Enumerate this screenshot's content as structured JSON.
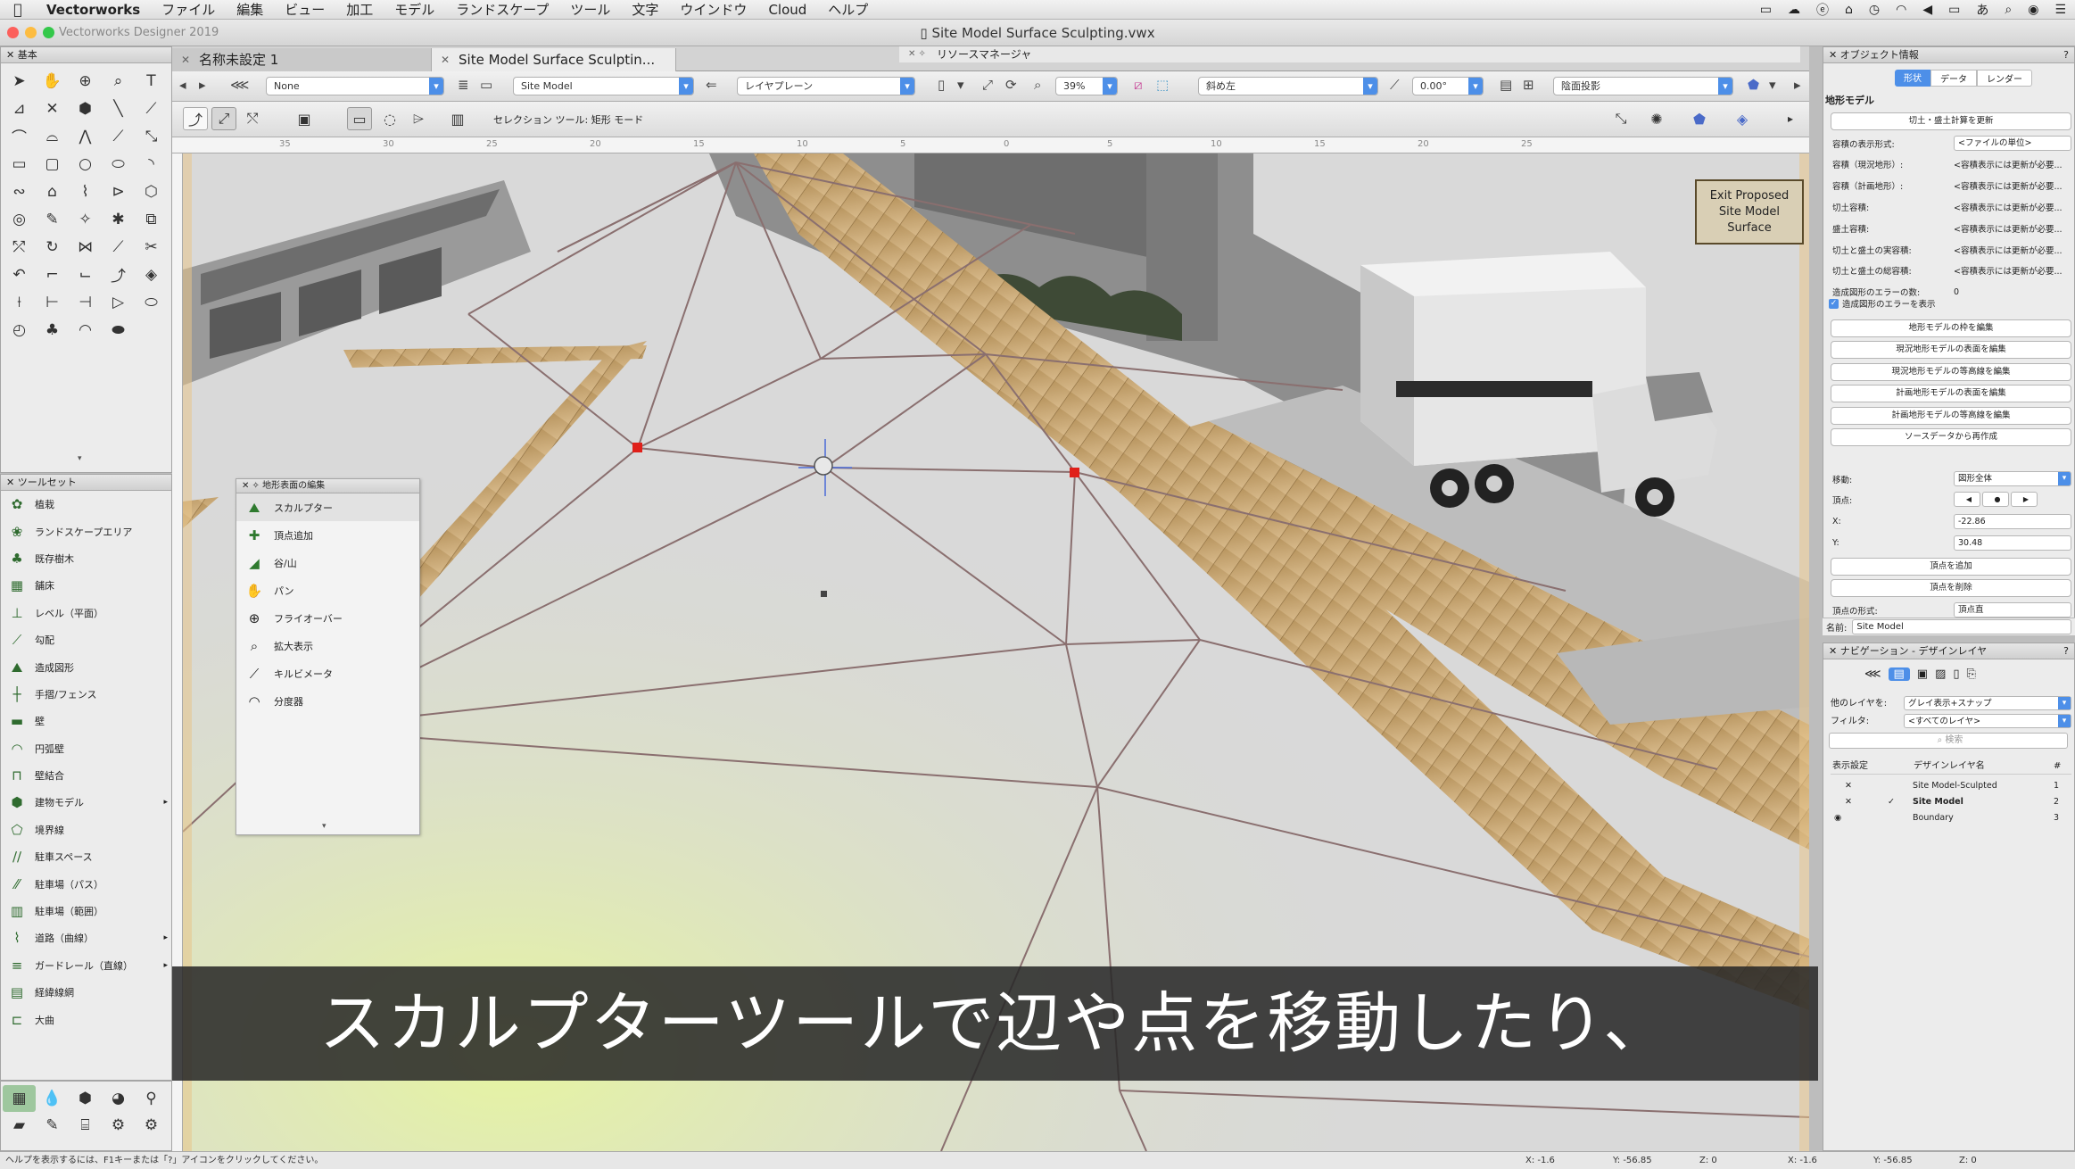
{
  "menubar": {
    "items": [
      "Vectorworks",
      "ファイル",
      "編集",
      "ビュー",
      "加工",
      "モデル",
      "ランドスケープ",
      "ツール",
      "文字",
      "ウインドウ",
      "Cloud",
      "ヘルプ"
    ]
  },
  "window": {
    "app_name": "Vectorworks Designer 2019",
    "title": "Site Model Surface Sculpting.vwx"
  },
  "tabs": [
    {
      "label": "名称未設定 1"
    },
    {
      "label": "Site Model Surface Sculptin..."
    },
    {
      "label": "リソースマネージャ"
    }
  ],
  "palettes": {
    "basic": "基本",
    "toolset": "ツールセット",
    "object_info": "オブジェクト情報",
    "navigation": "ナビゲーション - デザインレイヤ",
    "edit_surface": "地形表面の編集"
  },
  "viewbar": {
    "class": "None",
    "layer": "Site Model",
    "layer_plane": "レイヤプレーン",
    "zoom": "39%",
    "view": "斜め左",
    "angle": "0.00°",
    "render": "陰面投影"
  },
  "modebar": {
    "status": "セレクション ツール: 矩形 モード"
  },
  "ruler": {
    "ticks": [
      "35",
      "30",
      "25",
      "20",
      "15",
      "10",
      "5",
      "0",
      "5",
      "10",
      "15",
      "20",
      "25"
    ]
  },
  "toolset": [
    {
      "label": "植栽",
      "icon": "plant-icon"
    },
    {
      "label": "ランドスケープエリア",
      "icon": "landscape-area-icon"
    },
    {
      "label": "既存樹木",
      "icon": "existing-tree-icon"
    },
    {
      "label": "舗床",
      "icon": "hardscape-icon"
    },
    {
      "label": "レベル（平面）",
      "icon": "level-icon"
    },
    {
      "label": "勾配",
      "icon": "slope-icon"
    },
    {
      "label": "造成図形",
      "icon": "site-modifier-icon"
    },
    {
      "label": "手摺/フェンス",
      "icon": "railing-icon"
    },
    {
      "label": "壁",
      "icon": "wall-icon"
    },
    {
      "label": "円弧壁",
      "icon": "round-wall-icon"
    },
    {
      "label": "壁結合",
      "icon": "wall-join-icon"
    },
    {
      "label": "建物モデル",
      "icon": "building-model-icon"
    },
    {
      "label": "境界線",
      "icon": "boundary-icon"
    },
    {
      "label": "駐車スペース",
      "icon": "parking-space-icon"
    },
    {
      "label": "駐車場（パス）",
      "icon": "parking-path-icon"
    },
    {
      "label": "駐車場（範囲）",
      "icon": "parking-area-icon"
    },
    {
      "label": "道路（曲線）",
      "icon": "road-curve-icon"
    },
    {
      "label": "ガードレール（直線）",
      "icon": "guardrail-icon"
    },
    {
      "label": "経緯線網",
      "icon": "graticule-icon"
    },
    {
      "label": "大曲",
      "icon": "curve-road-icon"
    }
  ],
  "edit_surface_tools": [
    {
      "label": "スカルプター",
      "icon": "sculptor-icon"
    },
    {
      "label": "頂点追加",
      "icon": "add-vertex-icon"
    },
    {
      "label": "谷/山",
      "icon": "valley-ridge-icon"
    },
    {
      "label": "パン",
      "icon": "hand-icon"
    },
    {
      "label": "フライオーバー",
      "icon": "flyover-icon"
    },
    {
      "label": "拡大表示",
      "icon": "zoom-icon"
    },
    {
      "label": "キルビメータ",
      "icon": "measure-icon"
    },
    {
      "label": "分度器",
      "icon": "protractor-icon"
    }
  ],
  "exit_button": "Exit Proposed\nSite Model\nSurface",
  "subtitle": "スカルプターツールで辺や点を移動したり、",
  "object_info": {
    "tabs": [
      "形状",
      "データ",
      "レンダー"
    ],
    "object_type": "地形モデル",
    "update_button": "切土・盛土計算を更新",
    "rows": [
      {
        "label": "容積の表示形式:",
        "value": "<ファイルの単位>"
      },
      {
        "label": "容積（現況地形）:",
        "value": "<容積表示には更新が必要..."
      },
      {
        "label": "容積（計画地形）:",
        "value": "<容積表示には更新が必要..."
      },
      {
        "label": "切土容積:",
        "value": "<容積表示には更新が必要..."
      },
      {
        "label": "盛土容積:",
        "value": "<容積表示には更新が必要..."
      },
      {
        "label": "切土と盛土の実容積:",
        "value": "<容積表示には更新が必要..."
      },
      {
        "label": "切土と盛土の総容積:",
        "value": "<容積表示には更新が必要..."
      },
      {
        "label": "造成図形のエラーの数:",
        "value": "0"
      }
    ],
    "show_errors": "造成図形のエラーを表示",
    "buttons": [
      "地形モデルの枠を編集",
      "現況地形モデルの表面を編集",
      "現況地形モデルの等高線を編集",
      "計画地形モデルの表面を編集",
      "計画地形モデルの等高線を編集",
      "ソースデータから再作成"
    ],
    "move_label": "移動:",
    "move_value": "図形全体",
    "vertex_label": "頂点:",
    "x_label": "X:",
    "x_value": "-22.86",
    "y_label": "Y:",
    "y_value": "30.48",
    "vertex_buttons": [
      "頂点を追加",
      "頂点を削除"
    ],
    "vertex_type_label": "頂点の形式:",
    "vertex_type_value": "頂点直",
    "name_label": "名前:",
    "name_value": "Site Model"
  },
  "navigation": {
    "other_layers_label": "他のレイヤを:",
    "other_layers_value": "グレイ表示+スナップ",
    "filter_label": "フィルタ:",
    "filter_value": "<すべてのレイヤ>",
    "search_placeholder": "検索",
    "col_visibility": "表示設定",
    "col_name": "デザインレイヤ名",
    "col_num": "#",
    "layers": [
      {
        "name": "Site Model-Sculpted",
        "num": "1"
      },
      {
        "name": "Site Model",
        "num": "2"
      },
      {
        "name": "Boundary",
        "num": "3"
      }
    ]
  },
  "status": {
    "help": "ヘルプを表示するには、F1キーまたは「?」アイコンをクリックしてください。",
    "x1": "X: -1.6",
    "y1": "Y: -56.85",
    "z1": "Z: 0",
    "x2": "X: -1.6",
    "y2": "Y: -56.85",
    "z2": "Z: 0"
  }
}
